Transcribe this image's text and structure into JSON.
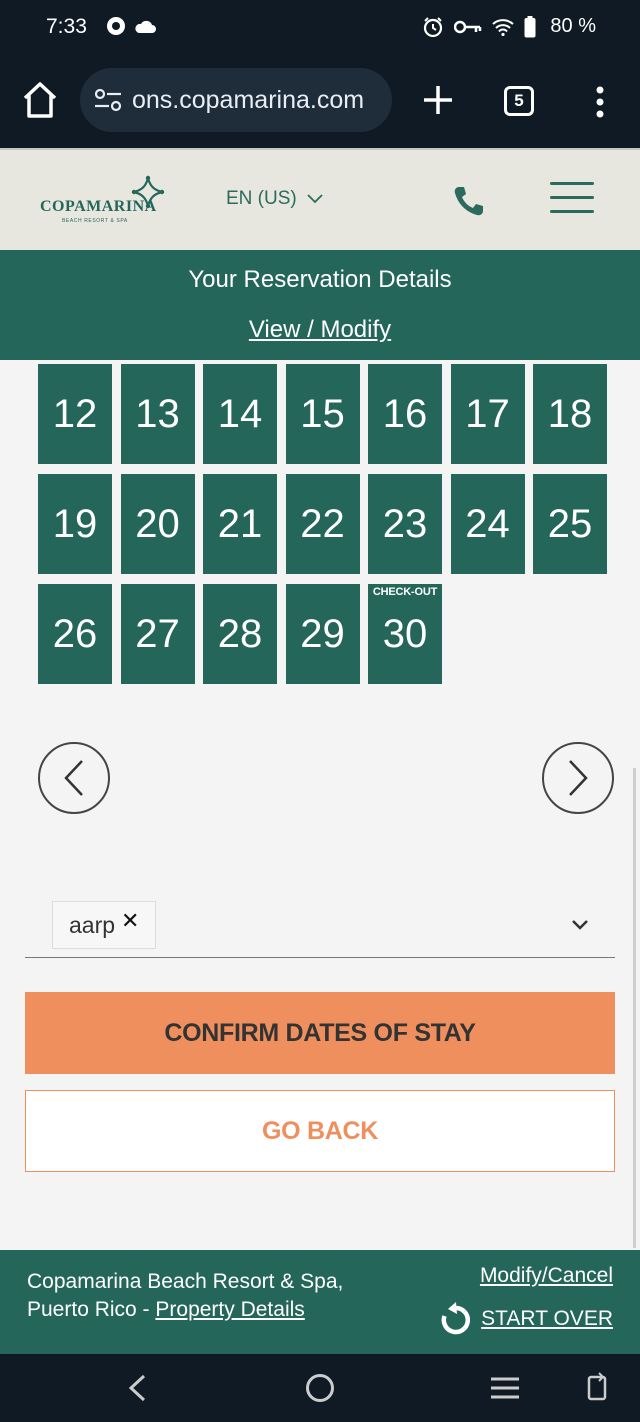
{
  "status_bar": {
    "time": "7:33",
    "battery": "80 %"
  },
  "browser": {
    "url": "ons.copamarina.com",
    "tab_count": "5"
  },
  "header": {
    "logo_name": "COPAMARINA",
    "logo_sub": "BEACH RESORT & SPA",
    "language": "EN (US)"
  },
  "reservation": {
    "title": "Your Reservation Details",
    "link": "View / Modify"
  },
  "calendar": {
    "rows": [
      [
        "12",
        "13",
        "14",
        "15",
        "16",
        "17",
        "18"
      ],
      [
        "19",
        "20",
        "21",
        "22",
        "23",
        "24",
        "25"
      ],
      [
        "26",
        "27",
        "28",
        "29",
        "30"
      ]
    ],
    "checkout_label": "CHECK-OUT"
  },
  "promo": {
    "selected": "aarp"
  },
  "actions": {
    "confirm": "CONFIRM DATES OF STAY",
    "back": "GO BACK"
  },
  "footer": {
    "line1": "Copamarina Beach Resort & Spa,",
    "line2_prefix": "Puerto Rico - ",
    "property_link": "Property Details",
    "modify_link": "Modify/Cancel",
    "start_over": "START OVER"
  },
  "colors": {
    "brand_green": "#24665a",
    "accent_orange": "#f08f5e",
    "header_bg": "#e8e7df",
    "system_bar": "#0f1a24"
  }
}
